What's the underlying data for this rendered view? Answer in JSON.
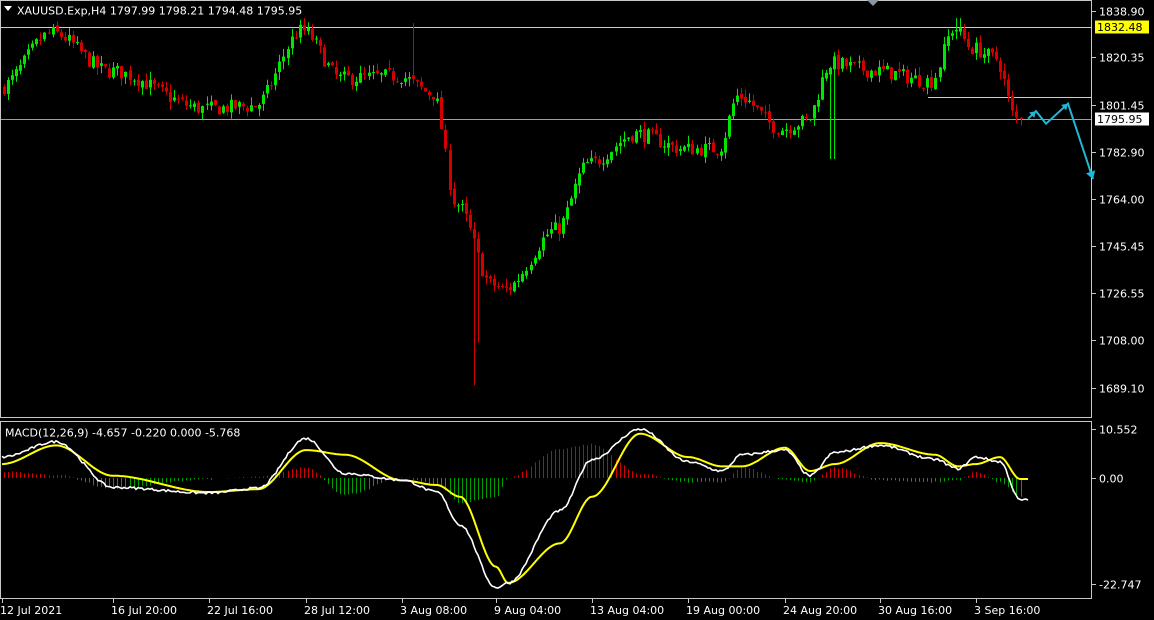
{
  "header": {
    "menu_icon": "triangle-down-icon",
    "text": "XAUUSD.Exp,H4  1797.99 1798.21 1794.48 1795.95"
  },
  "macd_header": "MACD(12,26,9) -4.657 -0.220 0.000 -5.768",
  "colors": {
    "background": "#000000",
    "bull": "#00e600",
    "bear": "#d40000",
    "macd_line": "#ffffff",
    "signal_line": "#ffff00",
    "hist_pos": "#d40000",
    "hist_neg": "#00a000",
    "frame": "#c8c8c8",
    "hline_yellow": "#e6e600",
    "hline_grey": "#8fa0b8",
    "arrow": "#1fb8d8",
    "price_tag_yellow": "#ffff00"
  },
  "chart_data": [
    {
      "type": "candlestick",
      "symbol": "XAUUSD.Exp",
      "timeframe": "H4",
      "ylim": [
        1680.6,
        1840.0
      ],
      "price_ticks": [
        "1838.90",
        "1820.35",
        "1801.45",
        "1782.90",
        "1764.00",
        "1745.45",
        "1726.55",
        "1708.00",
        "1689.10"
      ],
      "price_tags": [
        {
          "value": 1832.48,
          "label": "1832.48",
          "style": "yellow"
        },
        {
          "value": 1795.95,
          "label": "1795.95",
          "style": "white"
        }
      ],
      "horizontal_lines": [
        {
          "value": 1832.48,
          "color": "yellow",
          "full_width": true
        },
        {
          "value": 1795.95,
          "color": "grey",
          "full_width": true
        },
        {
          "value": 1804.5,
          "color": "yellow",
          "from": "3 Sep 16:00"
        }
      ],
      "anchors": [
        {
          "at": "12 Jul 2021",
          "close": 1808
        },
        {
          "at": "14 Jul",
          "close": 1830
        },
        {
          "at": "16 Jul 20:00",
          "close": 1815
        },
        {
          "at": "22 Jul 16:00",
          "close": 1800
        },
        {
          "at": "26 Jul",
          "close": 1801
        },
        {
          "at": "28 Jul 12:00",
          "close": 1831
        },
        {
          "at": "30 Jul",
          "close": 1812
        },
        {
          "at": "3 Aug 08:00",
          "close": 1813
        },
        {
          "at": "5 Aug",
          "close": 1806
        },
        {
          "at": "6 Aug",
          "close": 1762
        },
        {
          "at": "9 Aug 04:00",
          "close": 1730
        },
        {
          "at": "10 Aug",
          "close": 1728
        },
        {
          "at": "12 Aug",
          "close": 1752
        },
        {
          "at": "13 Aug 04:00",
          "close": 1778
        },
        {
          "at": "16 Aug",
          "close": 1790
        },
        {
          "at": "19 Aug 00:00",
          "close": 1784
        },
        {
          "at": "20 Aug",
          "close": 1784
        },
        {
          "at": "23 Aug",
          "close": 1805
        },
        {
          "at": "24 Aug 20:00",
          "close": 1792
        },
        {
          "at": "26 Aug",
          "close": 1795
        },
        {
          "at": "27 Aug",
          "close": 1818
        },
        {
          "at": "30 Aug 16:00",
          "close": 1815
        },
        {
          "at": "2 Sep",
          "close": 1811
        },
        {
          "at": "3 Sep",
          "close": 1832
        },
        {
          "at": "3 Sep 16:00",
          "close": 1824
        },
        {
          "at": "6 Sep",
          "close": 1820
        },
        {
          "at": "7 Sep",
          "close": 1796
        }
      ],
      "forecast_arrow": [
        {
          "at": "8 Sep",
          "price": 1796
        },
        {
          "at": "8 Sep 08:00",
          "price": 1799
        },
        {
          "at": "8 Sep 16:00",
          "price": 1794
        },
        {
          "at": "9 Sep",
          "price": 1802
        },
        {
          "at": "10 Sep",
          "price": 1772
        }
      ]
    },
    {
      "type": "line",
      "title": "MACD(12,26,9)",
      "ylim": [
        -25.5,
        11.8
      ],
      "y_ticks": [
        "10.552",
        "0.00",
        "-22.747"
      ],
      "anchors": [
        {
          "at": "12 Jul 2021",
          "macd": 4.5,
          "signal": 3.0
        },
        {
          "at": "14 Jul",
          "macd": 7.8,
          "signal": 7.0
        },
        {
          "at": "16 Jul 20:00",
          "macd": -2.0,
          "signal": 0.5
        },
        {
          "at": "22 Jul 16:00",
          "macd": -3.2,
          "signal": -3.0
        },
        {
          "at": "26 Jul",
          "macd": -2.2,
          "signal": -2.4
        },
        {
          "at": "28 Jul 12:00",
          "macd": 8.5,
          "signal": 6.0
        },
        {
          "at": "30 Jul",
          "macd": 1.0,
          "signal": 5.0
        },
        {
          "at": "3 Aug 08:00",
          "macd": -0.4,
          "signal": -0.5
        },
        {
          "at": "5 Aug",
          "macd": -3.0,
          "signal": -1.5
        },
        {
          "at": "6 Aug",
          "macd": -10.0,
          "signal": -4.0
        },
        {
          "at": "9 Aug 04:00",
          "macd": -23.5,
          "signal": -19.0
        },
        {
          "at": "10 Aug",
          "macd": -22.5,
          "signal": -22.5
        },
        {
          "at": "12 Aug",
          "macd": -7.0,
          "signal": -14.0
        },
        {
          "at": "13 Aug 04:00",
          "macd": 4.0,
          "signal": -4.0
        },
        {
          "at": "16 Aug",
          "macd": 10.5,
          "signal": 9.5
        },
        {
          "at": "19 Aug 00:00",
          "macd": 3.5,
          "signal": 4.5
        },
        {
          "at": "20 Aug",
          "macd": 1.5,
          "signal": 2.5
        },
        {
          "at": "23 Aug",
          "macd": 5.0,
          "signal": 2.5
        },
        {
          "at": "24 Aug 20:00",
          "macd": 6.0,
          "signal": 6.5
        },
        {
          "at": "26 Aug",
          "macd": 0.5,
          "signal": 1.5
        },
        {
          "at": "27 Aug",
          "macd": 5.5,
          "signal": 3.0
        },
        {
          "at": "30 Aug 16:00",
          "macd": 7.0,
          "signal": 7.5
        },
        {
          "at": "2 Sep",
          "macd": 4.0,
          "signal": 5.0
        },
        {
          "at": "3 Sep",
          "macd": 2.0,
          "signal": 2.5
        },
        {
          "at": "3 Sep 16:00",
          "macd": 4.5,
          "signal": 3.0
        },
        {
          "at": "6 Sep",
          "macd": 3.5,
          "signal": 4.5
        },
        {
          "at": "7 Sep",
          "macd": -4.7,
          "signal": -0.2
        }
      ]
    }
  ],
  "time_axis": {
    "labels": [
      "12 Jul 2021",
      "16 Jul 20:00",
      "22 Jul 16:00",
      "28 Jul 12:00",
      "3 Aug 08:00",
      "9 Aug 04:00",
      "13 Aug 04:00",
      "19 Aug 00:00",
      "24 Aug 20:00",
      "30 Aug 16:00",
      "3 Sep 16:00"
    ]
  }
}
